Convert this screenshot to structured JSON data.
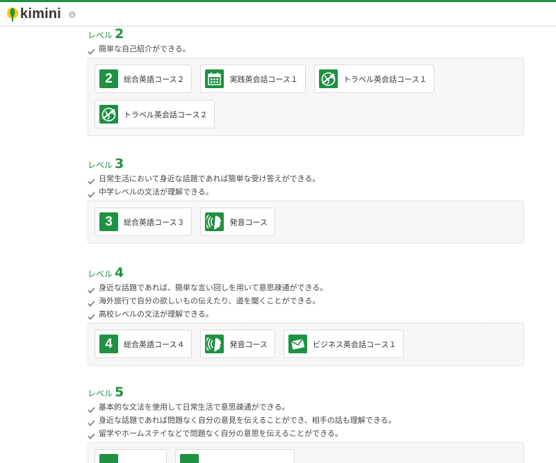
{
  "app": {
    "brand": "kimini",
    "accent_color": "#1e9142"
  },
  "header": {
    "history_icon": "clock-icon"
  },
  "levels": [
    {
      "label": "レベル",
      "number": "2",
      "points": [
        "簡単な自己紹介ができる。"
      ],
      "courses": [
        {
          "name": "総合英語コース２",
          "icon": "number-icon",
          "digit": "2"
        },
        {
          "name": "実践英会話コース１",
          "icon": "calendar-icon"
        },
        {
          "name": "トラベル英会話コース１",
          "icon": "travel-globe-icon"
        },
        {
          "name": "トラベル英会話コース２",
          "icon": "travel-globe-icon"
        }
      ]
    },
    {
      "label": "レベル",
      "number": "3",
      "points": [
        "日常生活において身近な話題であれば簡単な受け答えができる。",
        "中学レベルの文法が理解できる。"
      ],
      "courses": [
        {
          "name": "総合英語コース３",
          "icon": "number-icon",
          "digit": "3"
        },
        {
          "name": "発音コース",
          "icon": "pronunciation-icon"
        }
      ]
    },
    {
      "label": "レベル",
      "number": "4",
      "points": [
        "身近な話題であれば、簡単な言い回しを用いて意思疎通ができる。",
        "海外旅行で自分の欲しいもの伝えたり、道を聞くことができる。",
        "高校レベルの文法が理解できる。"
      ],
      "courses": [
        {
          "name": "総合英語コース４",
          "icon": "number-icon",
          "digit": "4"
        },
        {
          "name": "発音コース",
          "icon": "pronunciation-icon"
        },
        {
          "name": "ビジネス英会話コース１",
          "icon": "business-envelope-icon"
        }
      ]
    },
    {
      "label": "レベル",
      "number": "5",
      "points": [
        "基本的な文法を使用して日常生活で意思疎通ができる。",
        "身近な話題であれば問題なく自分の意見を伝えることができ、相手の話も理解できる。",
        "留学やホームステイなどで問題なく自分の意思を伝えることができる。"
      ],
      "courses": [
        {
          "name": "",
          "icon": "number-icon",
          "digit": ""
        },
        {
          "name": "",
          "icon": "number-icon",
          "digit": ""
        }
      ]
    }
  ]
}
